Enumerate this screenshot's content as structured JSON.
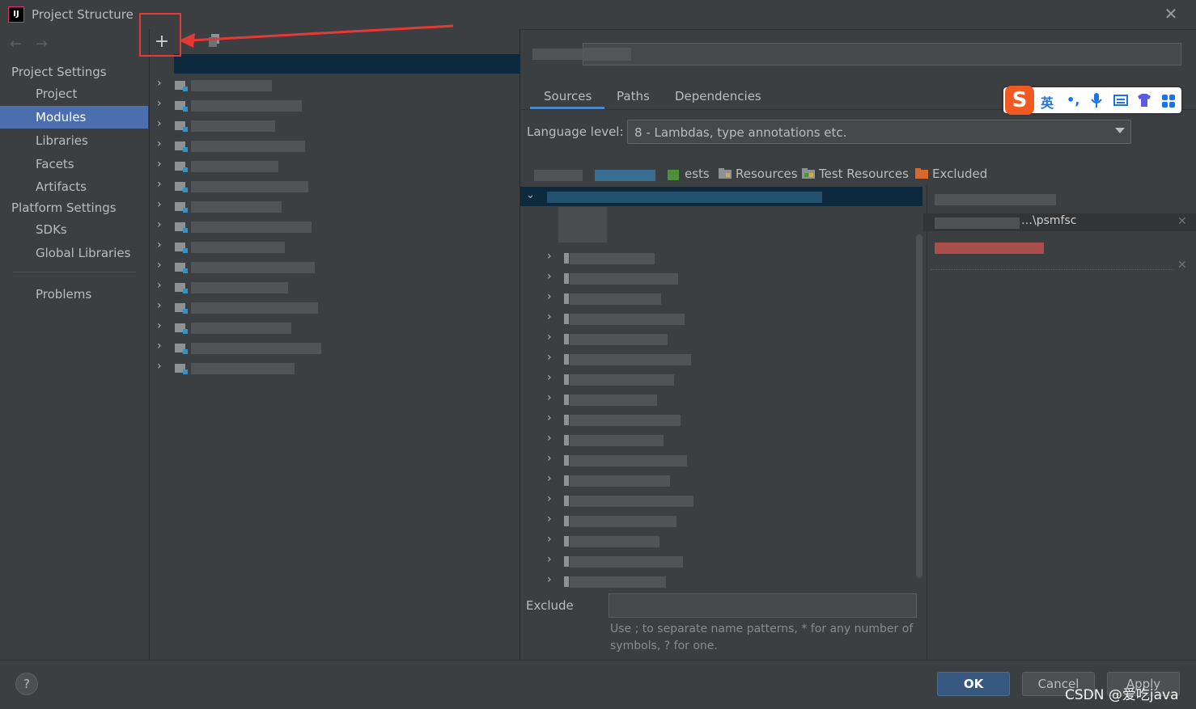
{
  "window": {
    "title": "Project Structure",
    "close_glyph": "✕",
    "logo_text": "IJ"
  },
  "sidebar": {
    "back_glyph": "←",
    "forward_glyph": "→",
    "project_settings_label": "Project Settings",
    "project_settings_items": [
      "Project",
      "Modules",
      "Libraries",
      "Facets",
      "Artifacts"
    ],
    "selected_item": "Modules",
    "platform_settings_label": "Platform Settings",
    "platform_settings_items": [
      "SDKs",
      "Global Libraries"
    ],
    "problems_label": "Problems"
  },
  "module_panel": {
    "add_glyph": "+",
    "chevron_glyph": "›",
    "row_count": 15
  },
  "details": {
    "tabs": [
      "Sources",
      "Paths",
      "Dependencies"
    ],
    "active_tab": "Sources",
    "language_level_label": "Language level:",
    "language_level_value": "8 - Lambdas, type annotations etc.",
    "mark_as": [
      {
        "label": "Resources",
        "color": "#8e9296"
      },
      {
        "label": "Test Resources",
        "color": "#8e9296"
      },
      {
        "label": "Excluded",
        "color": "#d46a2c"
      }
    ],
    "mark_partial": "ests",
    "content_root_partial": "…\\psmfsc",
    "exclude_label": "Exclude",
    "help_line1": "Use ; to separate name patterns, * for any number of",
    "help_line2": "symbols, ? for one."
  },
  "footer": {
    "help_glyph": "?",
    "ok_label": "OK",
    "cancel_label": "Cancel",
    "apply_label": "Apply"
  },
  "ime_toolbar": {
    "logo": "S",
    "lang": "英",
    "punct": "•,"
  },
  "watermark": "CSDN @爱吃java",
  "colors": {
    "accent_selected": "#4b6eaf",
    "annotation_red": "#e53935",
    "ok_button": "#365880"
  }
}
